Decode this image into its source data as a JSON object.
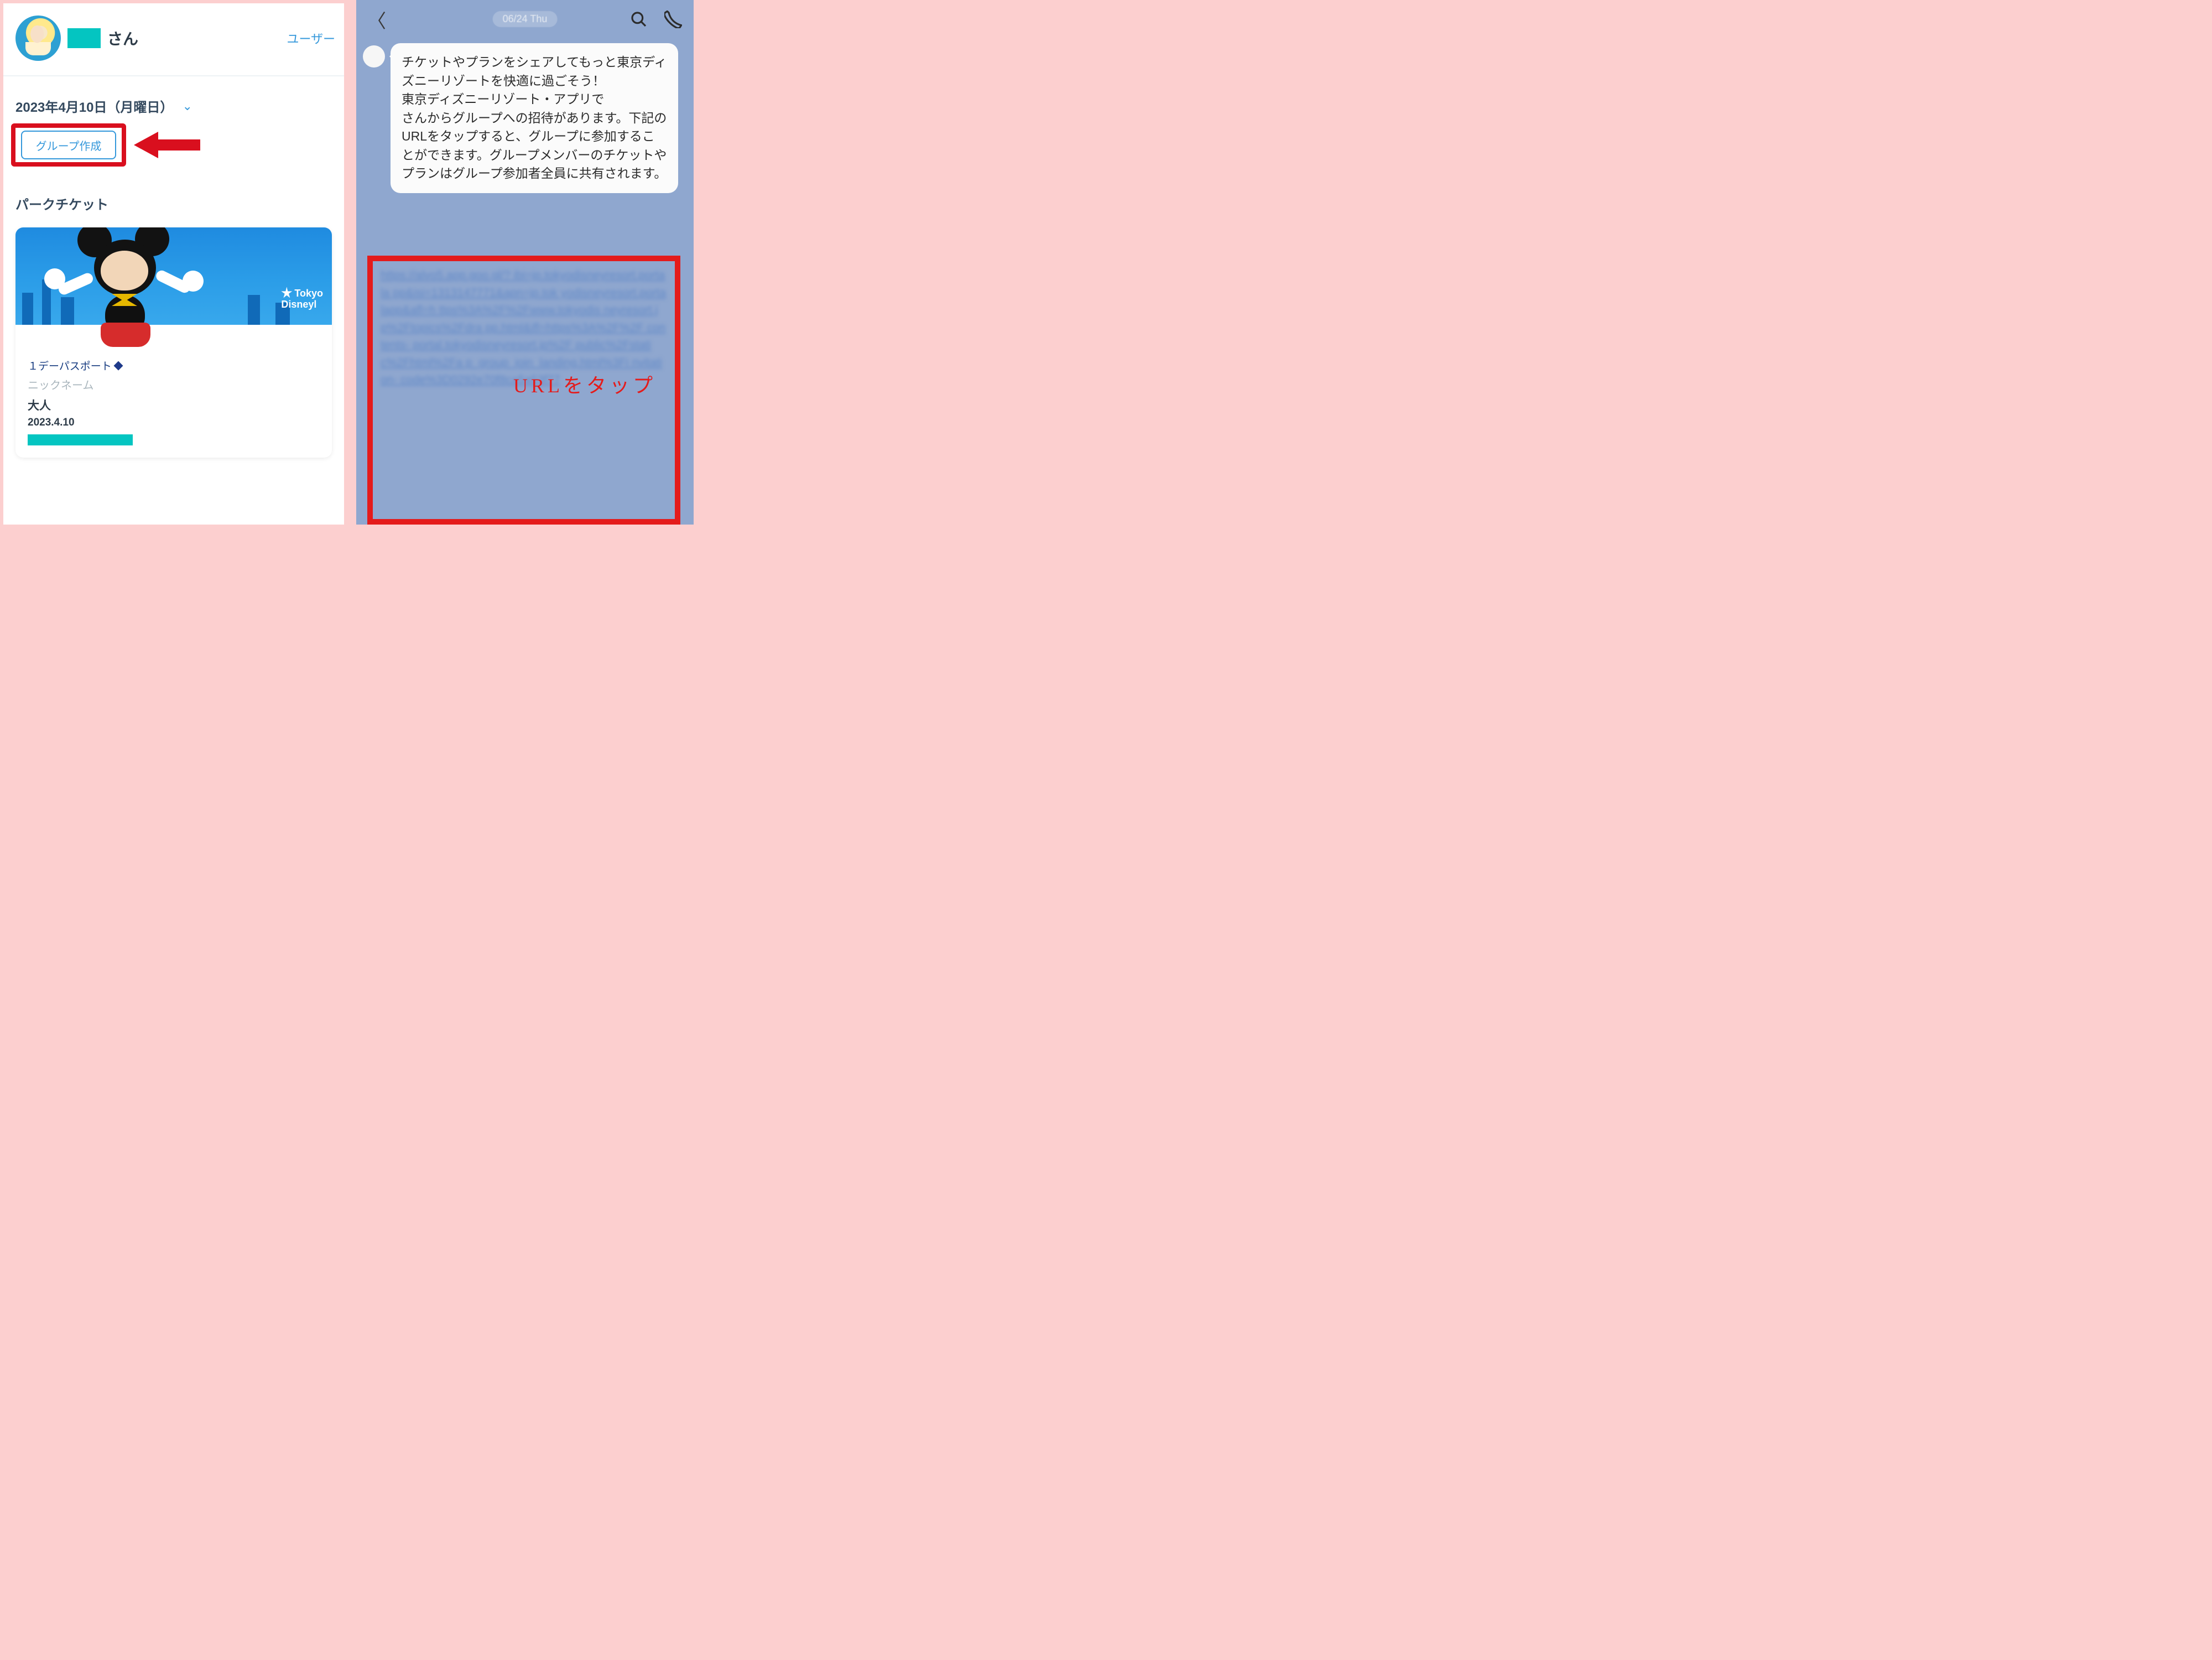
{
  "left": {
    "header": {
      "name_suffix": "さん",
      "user_link": "ユーザー"
    },
    "date": "2023年4月10日（月曜日）",
    "group_button": "グループ作成",
    "section_title": "パークチケット",
    "ticket": {
      "logo_line1": "Tokyo",
      "logo_line2": "Disneyl",
      "pass_type": "１デーパスポート",
      "nickname_label": "ニックネーム",
      "age": "大人",
      "date": "2023.4.10"
    }
  },
  "right": {
    "timestamp": "06/24 Thu",
    "message": "チケットやプランをシェアしてもっと東京ディズニーリゾートを快適に過ごそう！\n東京ディズニーリゾート・アプリで　　　　さんからグループへの招待があります。下記のURLをタップすると、グループに参加することができます。グループメンバーのチケットやプランはグループ参加者全員に共有されます。",
    "url_blurred": "https://alvo5.app.goo.gl/? ibi=jp.tokyodisneyresort.portala pp&isi=1313147771&apn=jp.tok yodisneyresort.portalapp&afl=h ttps%3A%2F%2Fwww.tokyodis neyresort.jp%2Ftopics%2Fdra pp.html&ifl=https%3A%2F%2F contents- portal.tokyodisneyresort.jp%2F public%2Fstatic%2Fhtml%2Fa p_group_join_landing.html%3Fi nvitation- code%3D0292e70f8ca5a53f77",
    "url_label": "URLをタップ"
  }
}
